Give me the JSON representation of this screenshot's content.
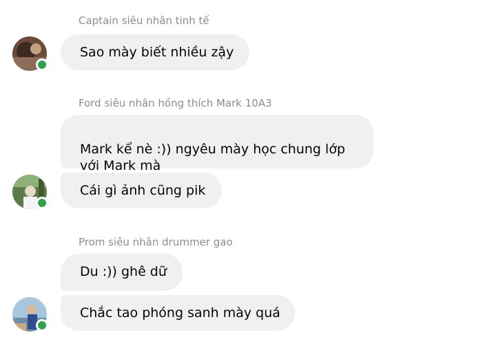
{
  "groups": [
    {
      "sender": "Captain siêu nhân tinh tế",
      "messages": [
        "Sao mày biết nhiều zậy"
      ]
    },
    {
      "sender": "Ford siêu nhân hồng thích Mark 10A3",
      "messages": [
        "Mark kể nè :)) ngyêu mày học chung lớp\nvới Mark mà",
        "Cái gì ảnh cũng pik"
      ]
    },
    {
      "sender": "Prom siêu nhân drummer gao",
      "messages": [
        "Du :)) ghê dữ",
        "Chắc tao phóng sanh mày quá"
      ]
    }
  ],
  "colors": {
    "bubble": "#f0f0f2",
    "online": "#31a24c",
    "sender_text": "#8a8d91"
  }
}
